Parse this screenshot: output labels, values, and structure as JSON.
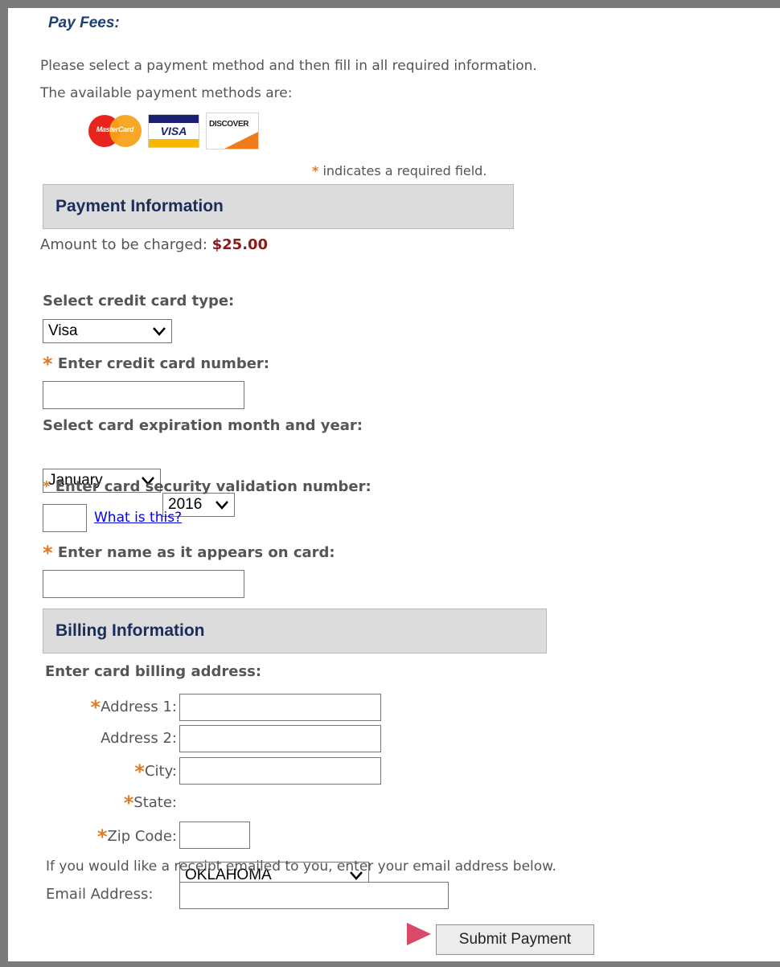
{
  "title": "Pay Fees:",
  "intro": {
    "line1": "Please select a payment method and then fill in all required information.",
    "line2": "The available payment methods are:"
  },
  "cards": [
    {
      "name": "mastercard-logo",
      "text": "MasterCard"
    },
    {
      "name": "visa-logo",
      "text": "VISA"
    },
    {
      "name": "discover-logo",
      "text": "DISCOVER"
    }
  ],
  "required_note": {
    "star": "*",
    "text": "indicates a required field."
  },
  "payment_section": {
    "title": "Payment Information",
    "amount_label": "Amount to be charged:",
    "amount_value": "$25.00",
    "card_type_label": "Select credit card type:",
    "card_type_value": "Visa",
    "card_number_label": "Enter credit card number:",
    "card_number_value": "",
    "expiration_label": "Select card expiration month and year:",
    "exp_month_value": "January",
    "exp_year_value": "2016",
    "cvv_label": "Enter card security validation number:",
    "cvv_value": "",
    "cvv_help_link": "What is this?",
    "name_label": "Enter name as it appears on card:",
    "name_value": ""
  },
  "billing_section": {
    "title": "Billing Information",
    "address_heading": "Enter card billing address:",
    "address1_label": "Address 1:",
    "address2_label": "Address 2:",
    "city_label": "City:",
    "state_label": "State:",
    "state_value": "OKLAHOMA",
    "zip_label": "Zip Code:",
    "receipt_note": "If you would like a receipt emailed to you, enter your email address below.",
    "email_label": "Email Address:",
    "email_value": ""
  },
  "submit_label": "Submit Payment",
  "colors": {
    "title": "#1c3f72",
    "section_text": "#1a2d5a",
    "section_bg": "#dcdcdc",
    "required_star": "#e07b22",
    "amount": "#8b1a1a",
    "link": "#0000ee",
    "frame": "#7b7b7b"
  }
}
